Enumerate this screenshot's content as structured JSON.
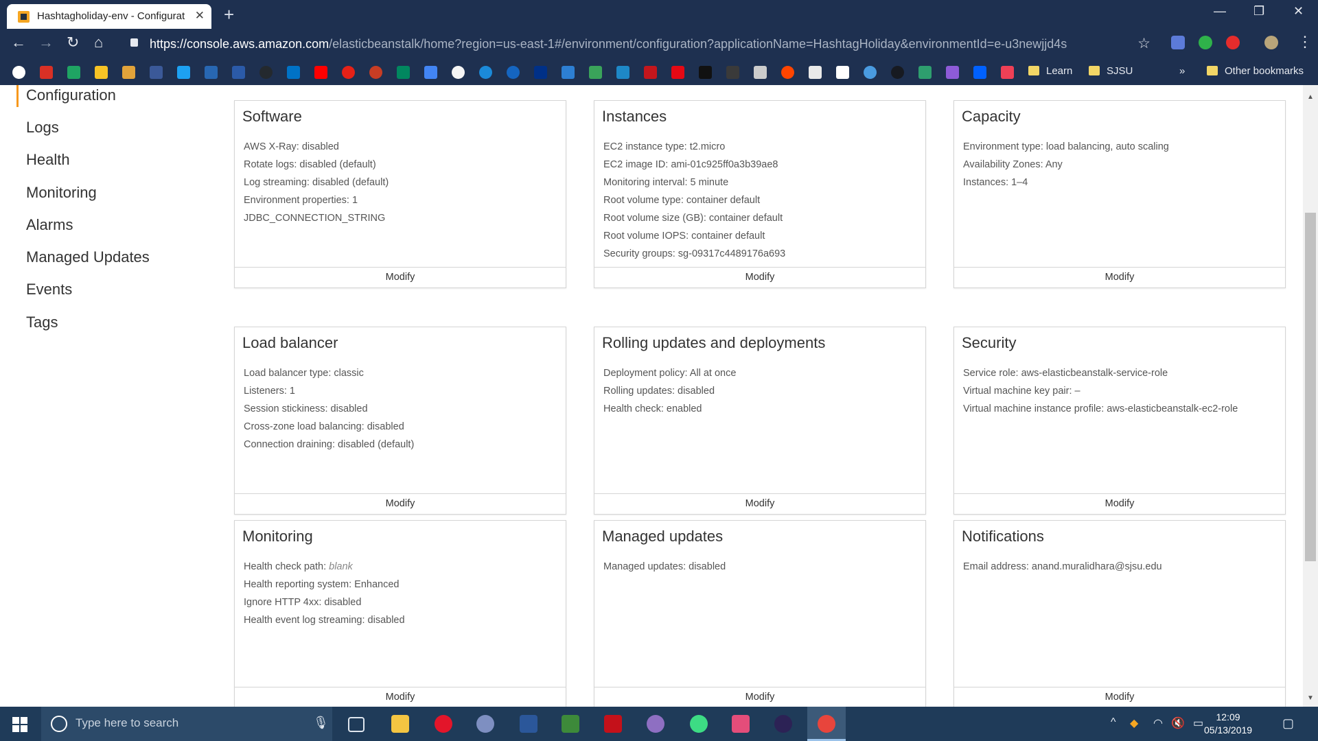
{
  "browser": {
    "tab_title": "Hashtagholiday-env - Configurat",
    "url_host": "https://console.aws.amazon.com",
    "url_path": "/elasticbeanstalk/home?region=us-east-1#/environment/configuration?applicationName=HashtagHoliday&environmentId=e-u3newjjd4s"
  },
  "bookmarks": {
    "learn": "Learn",
    "sjsu": "SJSU",
    "overflow": "»",
    "other": "Other bookmarks"
  },
  "sidebar": {
    "items": [
      "Configuration",
      "Logs",
      "Health",
      "Monitoring",
      "Alarms",
      "Managed Updates",
      "Events",
      "Tags"
    ]
  },
  "cards": [
    {
      "title": "Software",
      "lines": [
        "AWS X-Ray: disabled",
        "Rotate logs: disabled (default)",
        "Log streaming: disabled (default)",
        "Environment properties: 1",
        "JDBC_CONNECTION_STRING"
      ],
      "action": "Modify"
    },
    {
      "title": "Instances",
      "lines": [
        "EC2 instance type: t2.micro",
        "EC2 image ID: ami-01c925ff0a3b39ae8",
        "Monitoring interval: 5 minute",
        "Root volume type: container default",
        "Root volume size (GB): container default",
        "Root volume IOPS: container default",
        "Security groups: sg-09317c4489176a693"
      ],
      "action": "Modify"
    },
    {
      "title": "Capacity",
      "lines": [
        "Environment type: load balancing, auto scaling",
        "Availability Zones: Any",
        "Instances: 1–4"
      ],
      "action": "Modify"
    },
    {
      "title": "Load balancer",
      "lines": [
        "Load balancer type: classic",
        "Listeners: 1",
        "Session stickiness: disabled",
        "Cross-zone load balancing: disabled",
        "Connection draining: disabled (default)"
      ],
      "action": "Modify"
    },
    {
      "title": "Rolling updates and deployments",
      "lines": [
        "Deployment policy: All at once",
        "Rolling updates: disabled",
        "Health check: enabled"
      ],
      "action": "Modify"
    },
    {
      "title": "Security",
      "lines": [
        "Service role: aws-elasticbeanstalk-service-role",
        "Virtual machine key pair: –",
        "Virtual machine instance profile: aws-elasticbeanstalk-ec2-role"
      ],
      "action": "Modify"
    },
    {
      "title": "Monitoring",
      "lines": [
        "Health check path: ",
        "Health reporting system: Enhanced",
        "Ignore HTTP 4xx: disabled",
        "Health event log streaming: disabled"
      ],
      "italic_value": "blank",
      "action": "Modify"
    },
    {
      "title": "Managed updates",
      "lines": [
        "Managed updates: disabled"
      ],
      "action": "Modify"
    },
    {
      "title": "Notifications",
      "lines": [
        "Email address: anand.muralidhara@sjsu.edu"
      ],
      "action": "Modify"
    }
  ],
  "taskbar": {
    "search_placeholder": "Type here to search",
    "time": "12:09",
    "date": "05/13/2019"
  },
  "colors": {
    "chrome_frame": "#1e3050",
    "taskbar": "#1f3b59",
    "nav_accent": "#f7981d"
  }
}
